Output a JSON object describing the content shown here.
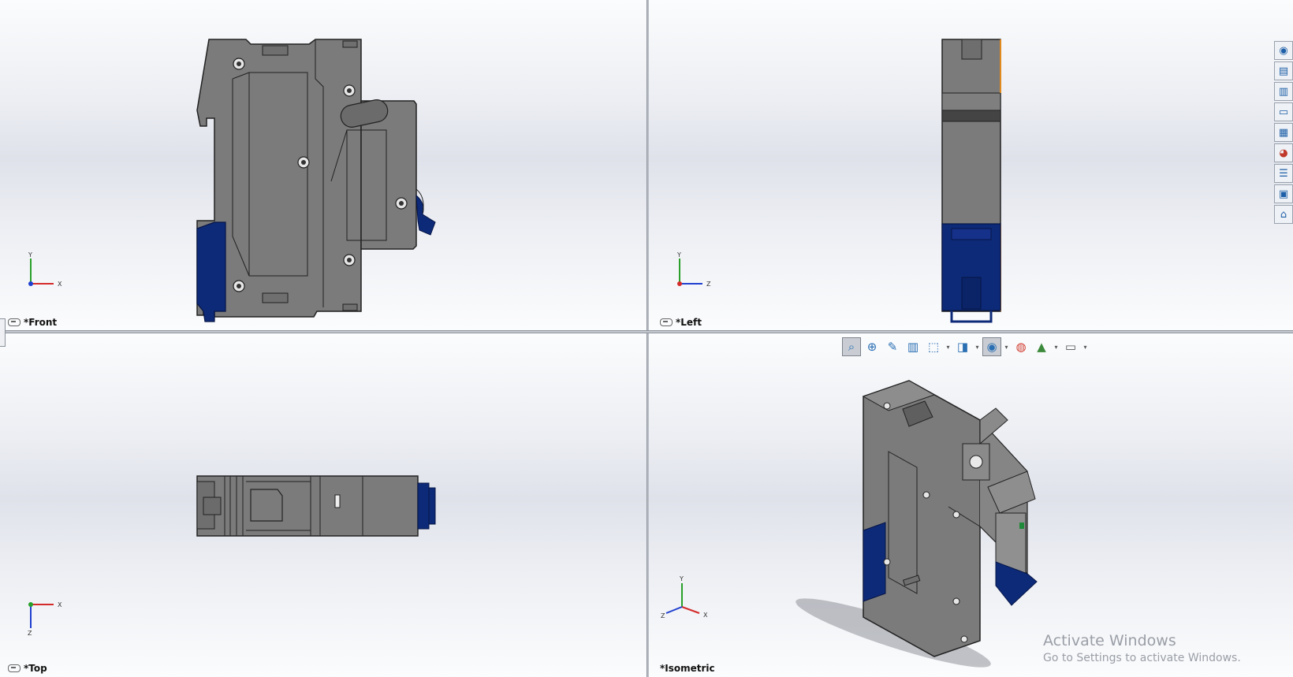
{
  "viewports": {
    "front": {
      "label": "*Front",
      "axes": {
        "x": "X",
        "y": "Y"
      }
    },
    "left": {
      "label": "*Left",
      "axes": {
        "x": "Z",
        "y": "Y"
      }
    },
    "top": {
      "label": "*Top",
      "axes": {
        "x": "X",
        "y": "Z"
      }
    },
    "isometric": {
      "label": "*Isometric",
      "axes": {
        "x": "X",
        "y": "Y",
        "z": "Z"
      }
    }
  },
  "task_pane": {
    "icons": [
      "solidworks-resources-icon",
      "design-library-icon",
      "file-explorer-icon",
      "view-palette-icon",
      "search-icon",
      "appearances-icon",
      "custom-properties-icon",
      "forum-icon",
      "home-icon"
    ]
  },
  "heads_up_toolbar": {
    "icons": [
      "zoom-to-fit-icon",
      "zoom-to-area-icon",
      "previous-view-icon",
      "section-view-icon",
      "view-orientation-icon",
      "display-style-icon",
      "hide-show-items-icon",
      "edit-appearance-icon",
      "apply-scene-icon",
      "view-settings-icon"
    ]
  },
  "watermark": {
    "title": "Activate Windows",
    "subtitle": "Go to Settings to activate Windows."
  },
  "colors": {
    "part_gray": "#7b7b7b",
    "part_dark": "#5a5a5a",
    "handle_blue": "#0d2a78",
    "accent_orange": "#e08a1e"
  }
}
